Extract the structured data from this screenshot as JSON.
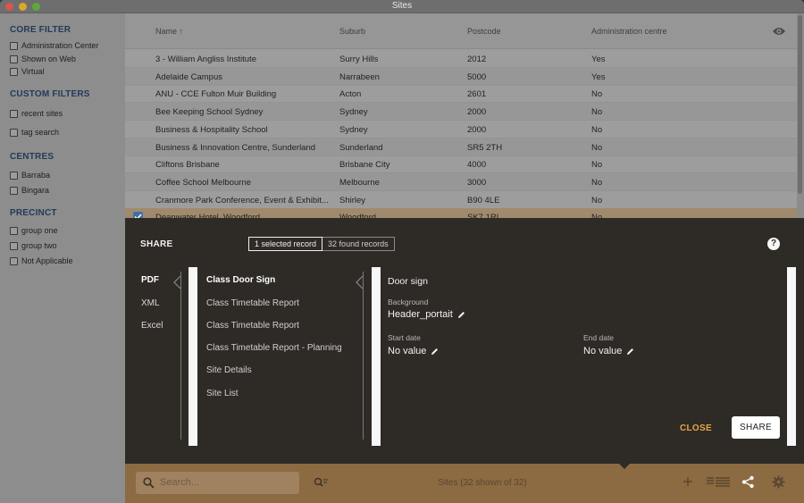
{
  "window": {
    "title": "Sites"
  },
  "sidebar": {
    "sections": [
      {
        "heading": "CORE FILTER",
        "items": [
          "Administration Center",
          "Shown on Web",
          "Virtual"
        ]
      },
      {
        "heading": "CUSTOM FILTERS",
        "items": [
          "recent sites",
          "tag search"
        ]
      },
      {
        "heading": "CENTRES",
        "items": [
          "Barraba",
          "Bingara"
        ]
      },
      {
        "heading": "PRECINCT",
        "items": [
          "group one",
          "group two",
          "Not Applicable"
        ]
      }
    ]
  },
  "table": {
    "columns": [
      "Name",
      "Suburb",
      "Postcode",
      "Administration centre"
    ],
    "sort_indicator": "↑",
    "rows": [
      [
        "3 - William Angliss Institute",
        "Surry Hills",
        "2012",
        "Yes"
      ],
      [
        "Adelaide Campus",
        "Narrabeen",
        "5000",
        "Yes"
      ],
      [
        "ANU - CCE Fulton Muir Building",
        "Acton",
        "2601",
        "No"
      ],
      [
        "Bee Keeping School Sydney",
        "Sydney",
        "2000",
        "No"
      ],
      [
        "Business & Hospitality School",
        "Sydney",
        "2000",
        "No"
      ],
      [
        "Business & Innovation Centre, Sunderland",
        "Sunderland",
        "SR5 2TH",
        "No"
      ],
      [
        "Cliftons Brisbane",
        "Brisbane City",
        "4000",
        "No"
      ],
      [
        "Coffee School Melbourne",
        "Melbourne",
        "3000",
        "No"
      ],
      [
        "Cranmore Park Conference, Event & Exhibit...",
        "Shirley",
        "B90 4LE",
        "No"
      ],
      [
        "Deanwater Hotel, Woodford",
        "Woodford",
        "SK7 1RL",
        "No"
      ]
    ]
  },
  "share": {
    "title": "SHARE",
    "segments": [
      "1 selected record",
      "32 found records"
    ],
    "help": "?",
    "formats": [
      "PDF",
      "XML",
      "Excel"
    ],
    "reports": [
      "Class Door Sign",
      "Class Timetable Report",
      "Class Timetable Report",
      "Class Timetable Report - Planning",
      "Site Details",
      "Site List"
    ],
    "detail": {
      "title": "Door sign",
      "background_label": "Background",
      "background_value": "Header_portait",
      "start_label": "Start date",
      "start_value": "No value",
      "end_label": "End date",
      "end_value": "No value"
    },
    "close_label": "CLOSE",
    "share_label": "SHARE"
  },
  "bottom": {
    "search_placeholder": "Search...",
    "status": "Sites (32 shown of 32)"
  },
  "colors": {
    "accent": "#e8a34a",
    "panel": "#2e2a26",
    "bottom_bar": "#8c6a42"
  }
}
